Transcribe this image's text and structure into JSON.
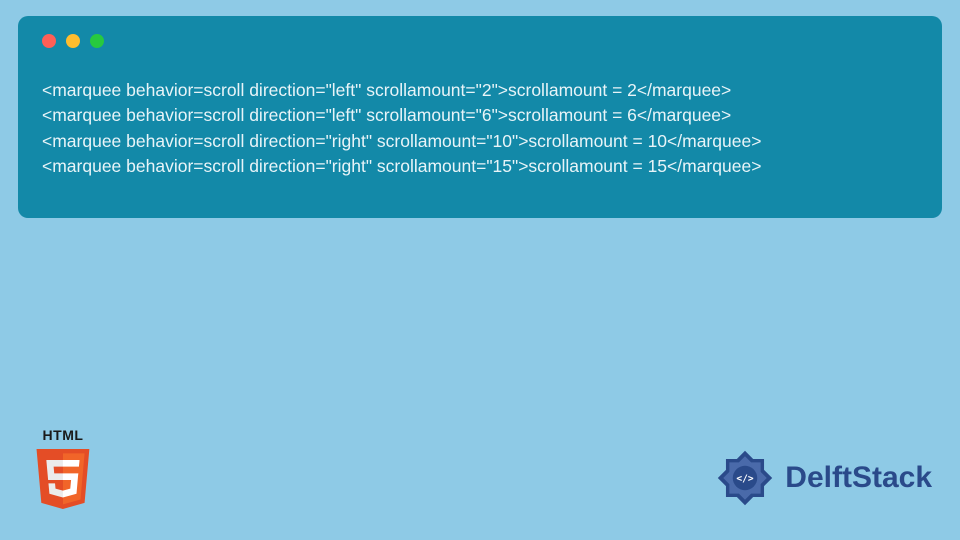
{
  "code": {
    "lines": [
      "<marquee behavior=scroll direction=\"left\" scrollamount=\"2\">scrollamount = 2</marquee>",
      "<marquee behavior=scroll direction=\"left\" scrollamount=\"6\">scrollamount = 6</marquee>",
      "<marquee behavior=scroll direction=\"right\" scrollamount=\"10\">scrollamount = 10</marquee>",
      "<marquee behavior=scroll direction=\"right\" scrollamount=\"15\">scrollamount = 15</marquee>"
    ]
  },
  "badges": {
    "html5_label": "HTML",
    "brand_name": "DelftStack"
  },
  "colors": {
    "page_bg": "#8ecae6",
    "window_bg": "#1389a8",
    "code_text": "#e8f4f8",
    "dot_red": "#ff5f56",
    "dot_yellow": "#ffbd2e",
    "dot_green": "#27c93f",
    "html5_orange": "#e44d26",
    "html5_orange_light": "#f16529",
    "brand_blue": "#2a4a8a"
  }
}
